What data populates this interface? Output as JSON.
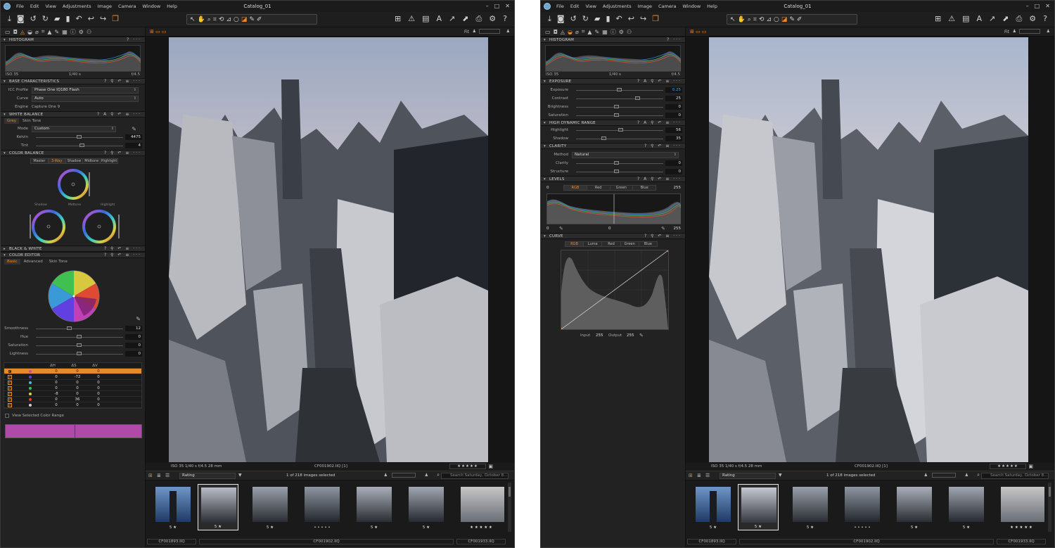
{
  "app": {
    "title": "Catalog_01",
    "menus": [
      "File",
      "Edit",
      "View",
      "Adjustments",
      "Image",
      "Camera",
      "Window",
      "Help"
    ],
    "window_controls": [
      "–",
      "□",
      "✕"
    ]
  },
  "colors": {
    "accent": "#e88a2c",
    "value_blue": "#4aa3ff",
    "color_range": "#b04aa8"
  },
  "histogram": {
    "title": "HISTOGRAM",
    "iso": "ISO 35",
    "shutter": "1/40 s",
    "aperture": "f/4.5"
  },
  "left_panel": {
    "base_characteristics": {
      "title": "BASE CHARACTERISTICS",
      "icc_label": "ICC Profile",
      "icc_value": "Phase One IQ180 Flash",
      "curve_label": "Curve",
      "curve_value": "Auto",
      "engine_label": "Engine",
      "engine_value": "Capture One 9"
    },
    "white_balance": {
      "title": "WHITE BALANCE",
      "tabs": [
        "Grey",
        "Skin Tone"
      ],
      "mode_label": "Mode",
      "mode_value": "Custom",
      "kelvin_label": "Kelvin",
      "kelvin_value": "4475",
      "tint_label": "Tint",
      "tint_value": "4"
    },
    "color_balance": {
      "title": "COLOR BALANCE",
      "modes": [
        "Master",
        "3-Way",
        "Shadow",
        "Midtone",
        "Highlight"
      ],
      "midtone_label": "Midtone",
      "shadow_label": "Shadow",
      "highlight_label": "Highlight"
    },
    "black_white": {
      "title": "BLACK & WHITE"
    },
    "color_editor": {
      "title": "COLOR EDITOR",
      "tabs": [
        "Basic",
        "Advanced",
        "Skin Tone"
      ],
      "smoothness_label": "Smoothness",
      "smoothness_value": "12",
      "hue_label": "Hue",
      "hue_value": "0",
      "saturation_label": "Saturation",
      "saturation_value": "0",
      "lightness_label": "Lightness",
      "lightness_value": "0",
      "table_headers": [
        "ΔH",
        "ΔS",
        "ΔV"
      ],
      "rows": [
        {
          "color": "#d040c0",
          "h": "0",
          "s": "0",
          "v": "0"
        },
        {
          "color": "#6040e0",
          "h": "0",
          "s": "-72",
          "v": "0"
        },
        {
          "color": "#40c0d0",
          "h": "0",
          "s": "0",
          "v": "0"
        },
        {
          "color": "#40c040",
          "h": "0",
          "s": "0",
          "v": "0"
        },
        {
          "color": "#e0d040",
          "h": "-8",
          "s": "0",
          "v": "0"
        },
        {
          "color": "#e04030",
          "h": "0",
          "s": "36",
          "v": "0"
        },
        {
          "color": "#d0d0d0",
          "h": "0",
          "s": "0",
          "v": "0"
        }
      ],
      "view_range_label": "View Selected Color Range"
    }
  },
  "right_panel": {
    "exposure": {
      "title": "EXPOSURE",
      "exposure_label": "Exposure",
      "exposure_value": "0.25",
      "contrast_label": "Contrast",
      "contrast_value": "25",
      "brightness_label": "Brightness",
      "brightness_value": "0",
      "saturation_label": "Saturation",
      "saturation_value": "0"
    },
    "hdr": {
      "title": "HIGH DYNAMIC RANGE",
      "highlight_label": "Highlight",
      "highlight_value": "56",
      "shadow_label": "Shadow",
      "shadow_value": "35"
    },
    "clarity": {
      "title": "CLARITY",
      "method_label": "Method",
      "method_value": "Natural",
      "clarity_label": "Clarity",
      "clarity_value": "0",
      "structure_label": "Structure",
      "structure_value": "0"
    },
    "levels": {
      "title": "LEVELS",
      "channels": [
        "RGB",
        "Red",
        "Green",
        "Blue"
      ],
      "top_left": "0",
      "top_right": "255",
      "bottom_left": "0",
      "bottom_mid": "0",
      "bottom_right": "255"
    },
    "curve": {
      "title": "CURVE",
      "channels": [
        "RGB",
        "Luma",
        "Red",
        "Green",
        "Blue"
      ],
      "input_label": "Input",
      "input_value": "255",
      "output_label": "Output",
      "output_value": "255"
    }
  },
  "viewer": {
    "zoom": "Fit",
    "meta": "ISO 35  1/40 s  f/4.5  28 mm",
    "filename": "CF001902.IIQ [1]",
    "stars": "★★★★★"
  },
  "browser": {
    "sort_value": "Rating",
    "selected": "1 of 218 images selected",
    "search_placeholder": "Search Saturday, October 8...",
    "thumbs": [
      {
        "stars": "5 ★"
      },
      {
        "stars": "5 ★"
      },
      {
        "stars": "5 ★"
      },
      {
        "stars": "• • • • •"
      },
      {
        "stars": "5 ★"
      },
      {
        "stars": "5 ★"
      },
      {
        "stars": "★ ★ ★ ★ ★"
      }
    ],
    "names": [
      "CF001893.IIQ",
      "CF001902.IIQ",
      "CF001933.IIQ"
    ]
  }
}
